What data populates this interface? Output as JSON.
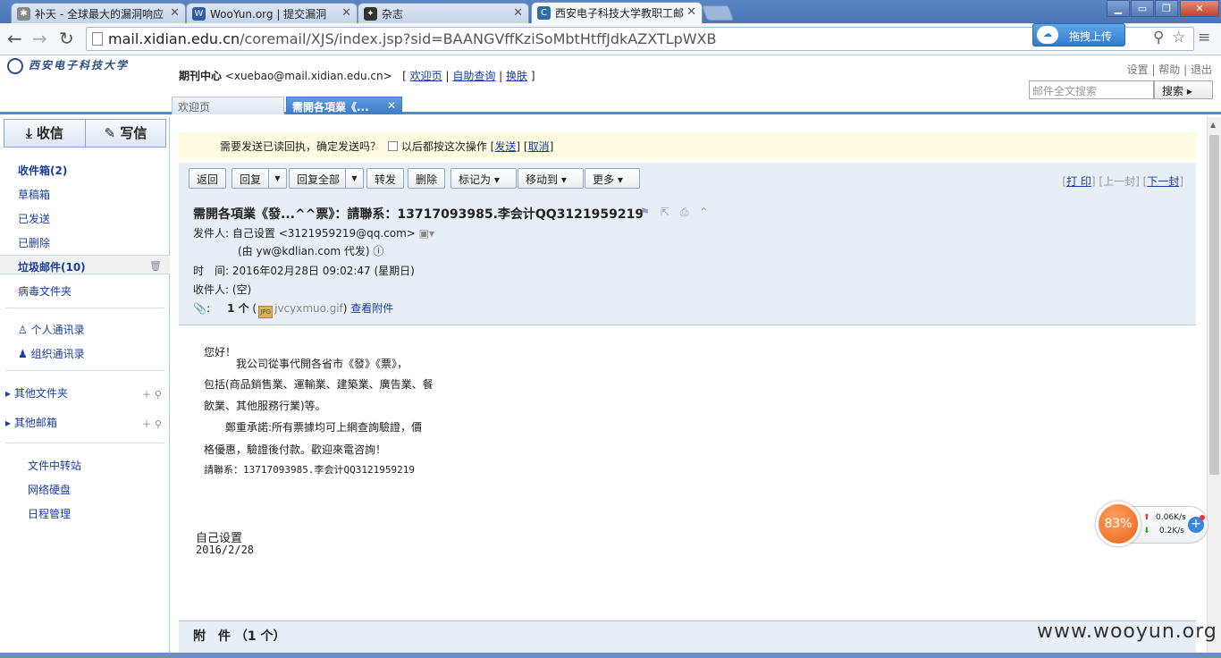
{
  "browser": {
    "tabs": [
      {
        "title": "补天 - 全球最大的漏洞响应",
        "icon": "star-icon"
      },
      {
        "title": "WooYun.org | 提交漏洞",
        "icon": "wooyun-icon"
      },
      {
        "title": "杂志",
        "icon": "magazine-icon"
      },
      {
        "title": "西安电子科技大学教职工邮",
        "icon": "coremail-icon"
      }
    ],
    "url_host": "mail.xidian.edu.cn",
    "url_path": "/coremail/XJS/index.jsp?sid=BAANGVffKziSoMbtHtffJdkAZXTLpWXB",
    "extension_label": "拖拽上传"
  },
  "header": {
    "logo_text": "西安电子科技大学",
    "dept": "期刊中心",
    "email": "<xuebao@mail.xidian.edu.cn>",
    "links": [
      "欢迎页",
      "自助查询",
      "换肤"
    ],
    "top_links": [
      "设置",
      "帮助",
      "退出"
    ],
    "search_placeholder": "邮件全文搜索",
    "search_button": "搜索"
  },
  "mail_tabs": [
    {
      "label": "欢迎页"
    },
    {
      "label": "需開各項業《..."
    }
  ],
  "sidebar": {
    "compose": [
      "收信",
      "写信"
    ],
    "folders": [
      "收件箱(2)",
      "草稿箱",
      "已发送",
      "已删除",
      "垃圾邮件(10)",
      "病毒文件夹"
    ],
    "contacts": [
      "个人通讯录",
      "组织通讯录"
    ],
    "groups": [
      "其他文件夹",
      "其他邮箱"
    ],
    "tools": [
      "文件中转站",
      "网络硬盘",
      "日程管理"
    ]
  },
  "notice": {
    "text": "需要发送已读回执，确定发送吗？",
    "checkbox_label": "以后都按这次操作",
    "send": "发送",
    "cancel": "取消"
  },
  "actions": {
    "buttons": [
      "返回",
      "回复",
      "回复全部",
      "转发",
      "删除",
      "标记为",
      "移动到",
      "更多"
    ],
    "print": "打 印",
    "prev": "上一封",
    "next": "下一封"
  },
  "mail": {
    "subject": "需開各項業《發...^^票》：請聯系：13717093985.李会计QQ3121959219",
    "from_label": "发件人:",
    "from": "自己设置 <3121959219@qq.com>",
    "via": "(由 yw@kdlian.com 代发)",
    "time_label": "时　间:",
    "time": "2016年02月28日 09:02:47 (星期日)",
    "to_label": "收件人:",
    "to": "(空)",
    "attach_count": "1 个",
    "attach_name": "jvcyxmuo.gif",
    "view_attach": "查看附件",
    "body": [
      "您好！",
      "我公司從事代開各省市《發》《票》，",
      "包括(商品銷售業、運輸業、建築業、廣告業、餐",
      "飲業、其他服務行業)等。",
      "鄭重承諾:所有票據均可上網查詢驗證，價",
      "格優惠，驗證後付款。歡迎來電咨詢！",
      "請聯系：13717093985.李会计QQ3121959219"
    ],
    "signature_name": "自己设置",
    "signature_date": "2016/2/28",
    "attach_header": "附　件 （1 个）"
  },
  "net_widget": {
    "percent": "83%",
    "up": "0.06K/s",
    "down": "0.2K/s"
  },
  "watermark": "www.wooyun.org"
}
